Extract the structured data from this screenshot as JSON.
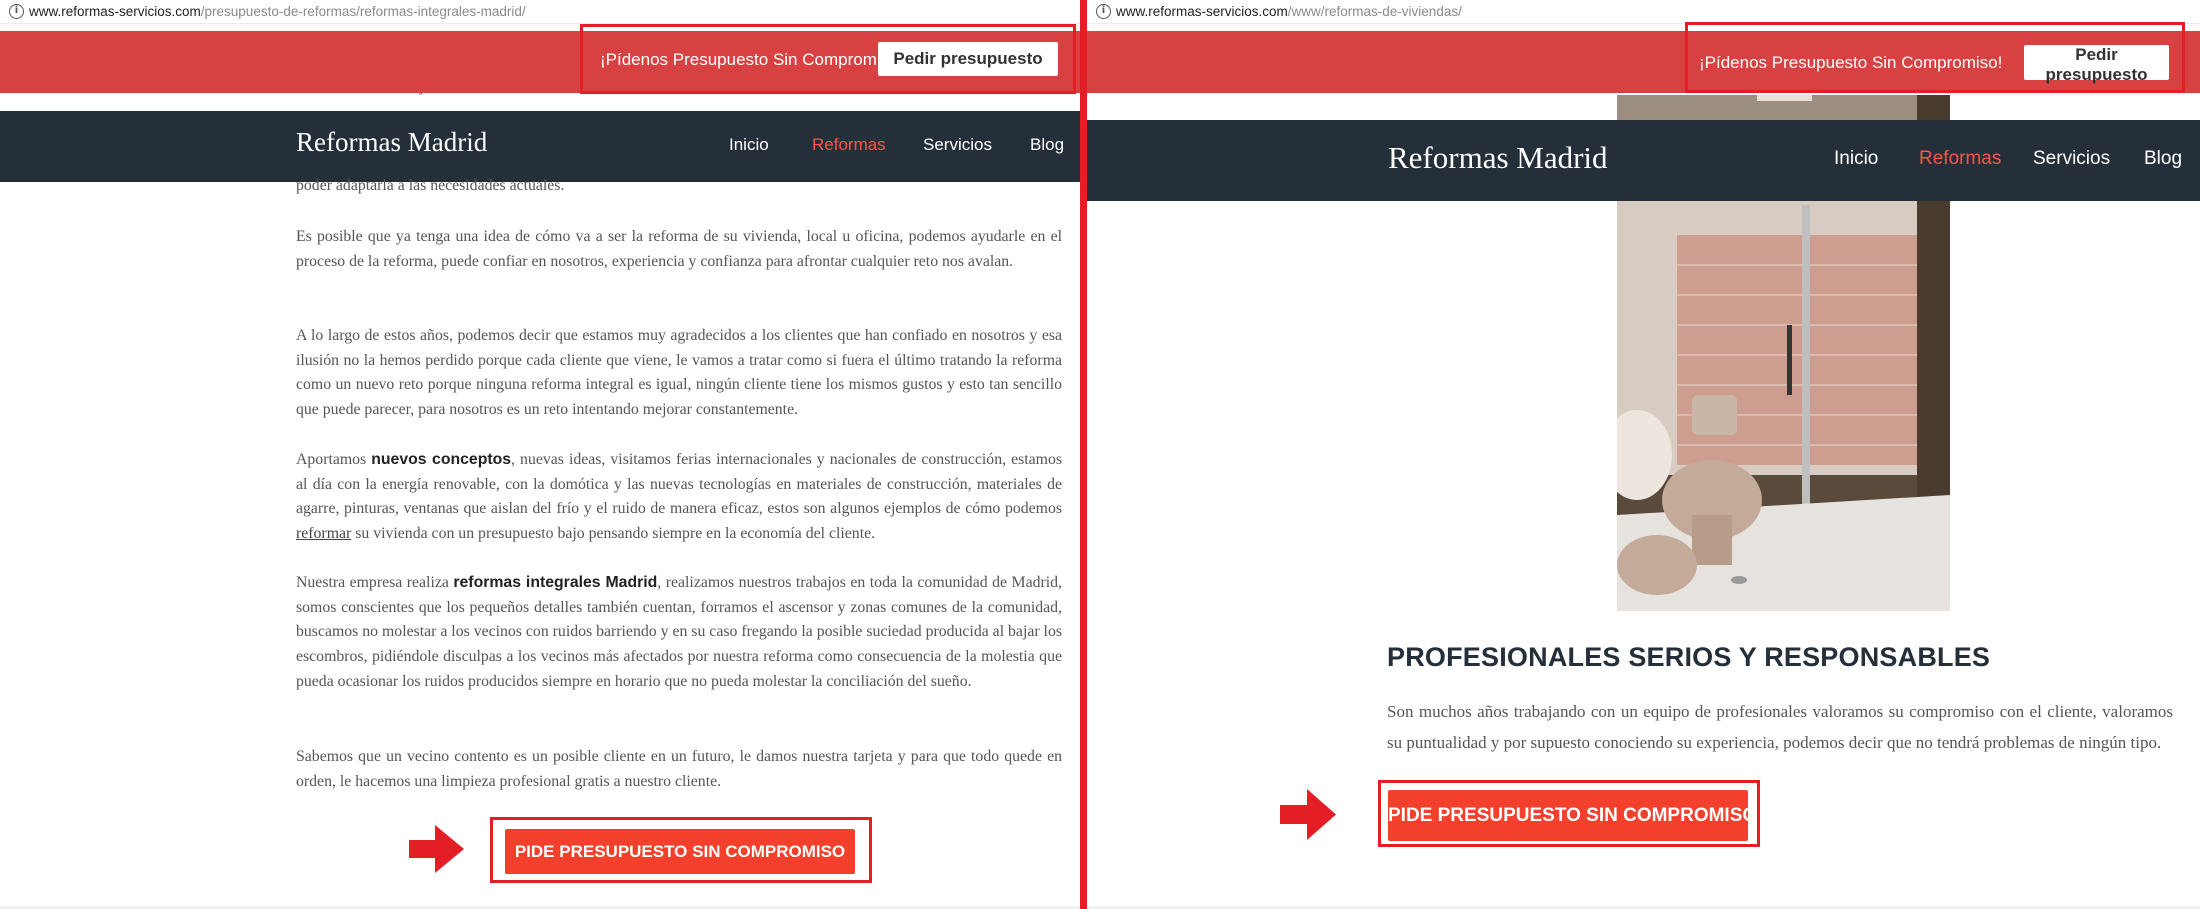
{
  "left_page": {
    "url_host": "www.reformas-servicios.com",
    "url_path": "/presupuesto-de-reformas/reformas-integrales-madrid/",
    "promo_text": "¡Pídenos Presupuesto Sin Compromiso!",
    "promo_button": "Pedir presupuesto",
    "logo": "Reformas Madrid",
    "nav": [
      "Inicio",
      "Reformas",
      "Servicios",
      "Blog"
    ],
    "active_nav": "Reformas",
    "frag_top": "confianza con trabajos con calidad.",
    "frag_under_nav": "poder adaptarla a las necesidades actuales.",
    "paragraphs": {
      "p1": "Es posible que ya tenga una idea de cómo va a ser la reforma de su vivienda, local u oficina, podemos ayudarle en el proceso de la reforma, puede confiar en nosotros, experiencia y confianza para afrontar cualquier reto nos avalan.",
      "p2": "A lo largo de estos años, podemos decir que estamos muy agradecidos a los clientes que han confiado en nosotros y esa ilusión no la hemos perdido porque cada cliente que viene, le vamos a tratar como si fuera el último tratando la reforma como un nuevo reto porque ninguna reforma integral es igual, ningún cliente tiene los mismos gustos y esto tan sencillo que puede parecer, para nosotros es un reto intentando mejorar constantemente.",
      "p3_a": "Aportamos ",
      "p3_bold": "nuevos conceptos",
      "p3_b": ", nuevas ideas, visitamos ferias internacionales y nacionales de construcción, estamos al día con la energía renovable, con la domótica y las nuevas tecnologías en materiales de construcción, materiales de agarre, pinturas, ventanas que aislan del frío y el ruido de manera eficaz, estos son algunos ejemplos de cómo podemos ",
      "p3_link": "reformar",
      "p3_c": " su vivienda con un presupuesto bajo pensando siempre en la economía del cliente.",
      "p4_a": "Nuestra empresa realiza ",
      "p4_bold": "reformas integrales Madrid",
      "p4_b": ", realizamos nuestros trabajos en toda la comunidad de Madrid, somos conscientes que los pequeños detalles también cuentan, forramos el ascensor y zonas comunes de la comunidad, buscamos no molestar a los vecinos con ruidos barriendo y en su caso fregando la posible suciedad producida al bajar los escombros, pidiéndole disculpas a los vecinos más afectados por nuestra reforma como consecuencia de la molestia que pueda ocasionar los ruidos producidos siempre en horario que no pueda molestar la conciliación del sueño.",
      "p5": "Sabemos que un vecino contento es un posible cliente en un futuro, le damos nuestra tarjeta y para que todo quede en orden, le hacemos una limpieza profesional gratis a nuestro cliente."
    },
    "cta": "PIDE PRESUPUESTO SIN COMPROMISO"
  },
  "right_page": {
    "url_host": "www.reformas-servicios.com",
    "url_path": "/www/reformas-de-viviendas/",
    "promo_text": "¡Pídenos Presupuesto Sin Compromiso!",
    "promo_button": "Pedir presupuesto",
    "logo": "Reformas Madrid",
    "nav": [
      "Inicio",
      "Reformas",
      "Servicios",
      "Blog"
    ],
    "active_nav": "Reformas",
    "heading": "PROFESIONALES SERIOS Y RESPONSABLES",
    "description": "Son muchos años trabajando con un equipo de profesionales valoramos su compromiso con el cliente, valoramos su puntualidad y por supuesto conociendo su experiencia, podemos decir que no tendrá problemas de ningún tipo.",
    "cta": "PIDE PRESUPUESTO SIN COMPROMISO"
  },
  "colors": {
    "promo_bar": "#d84141",
    "navbar": "#252f39",
    "active_nav": "#ff5447",
    "cta_button": "#f3402c",
    "highlight": "#e41e25"
  },
  "icons": [
    "info-icon",
    "arrow-right-icon",
    "bathroom-photo"
  ]
}
